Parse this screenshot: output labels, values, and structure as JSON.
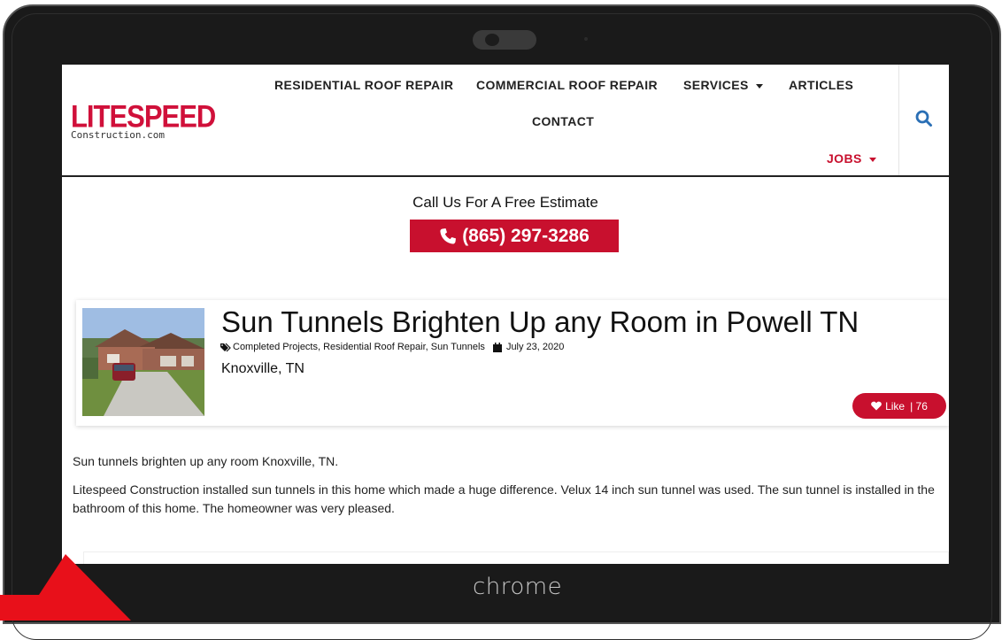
{
  "device": {
    "brand": "chrome"
  },
  "header": {
    "logo_main": "LITESPEED",
    "logo_sub": "Construction.com",
    "nav": {
      "residential": "RESIDENTIAL ROOF REPAIR",
      "commercial": "COMMERCIAL ROOF REPAIR",
      "services": "SERVICES",
      "articles": "ARTICLES",
      "contact": "CONTACT",
      "jobs": "JOBS"
    },
    "search_icon": "search-icon"
  },
  "estimate": {
    "text": "Call Us For A Free Estimate",
    "phone": "(865) 297-3286"
  },
  "article": {
    "title": "Sun Tunnels Brighten Up any Room in Powell TN",
    "categories": "Completed Projects, Residential Roof Repair, Sun Tunnels",
    "date": "July 23, 2020",
    "location": "Knoxville,  TN",
    "like_label": "Like",
    "like_count": "| 76",
    "paragraph1": "Sun tunnels brighten up any room Knoxville, TN.",
    "paragraph2": "Litespeed Construction installed sun tunnels in this home which made a huge difference.  Velux 14 inch sun tunnel was used.  The sun tunnel is installed in the bathroom of this home.  The homeowner was very pleased."
  },
  "colors": {
    "accent": "#c8102e",
    "bezel": "#1a1a1a",
    "arrow": "#e8101a"
  }
}
